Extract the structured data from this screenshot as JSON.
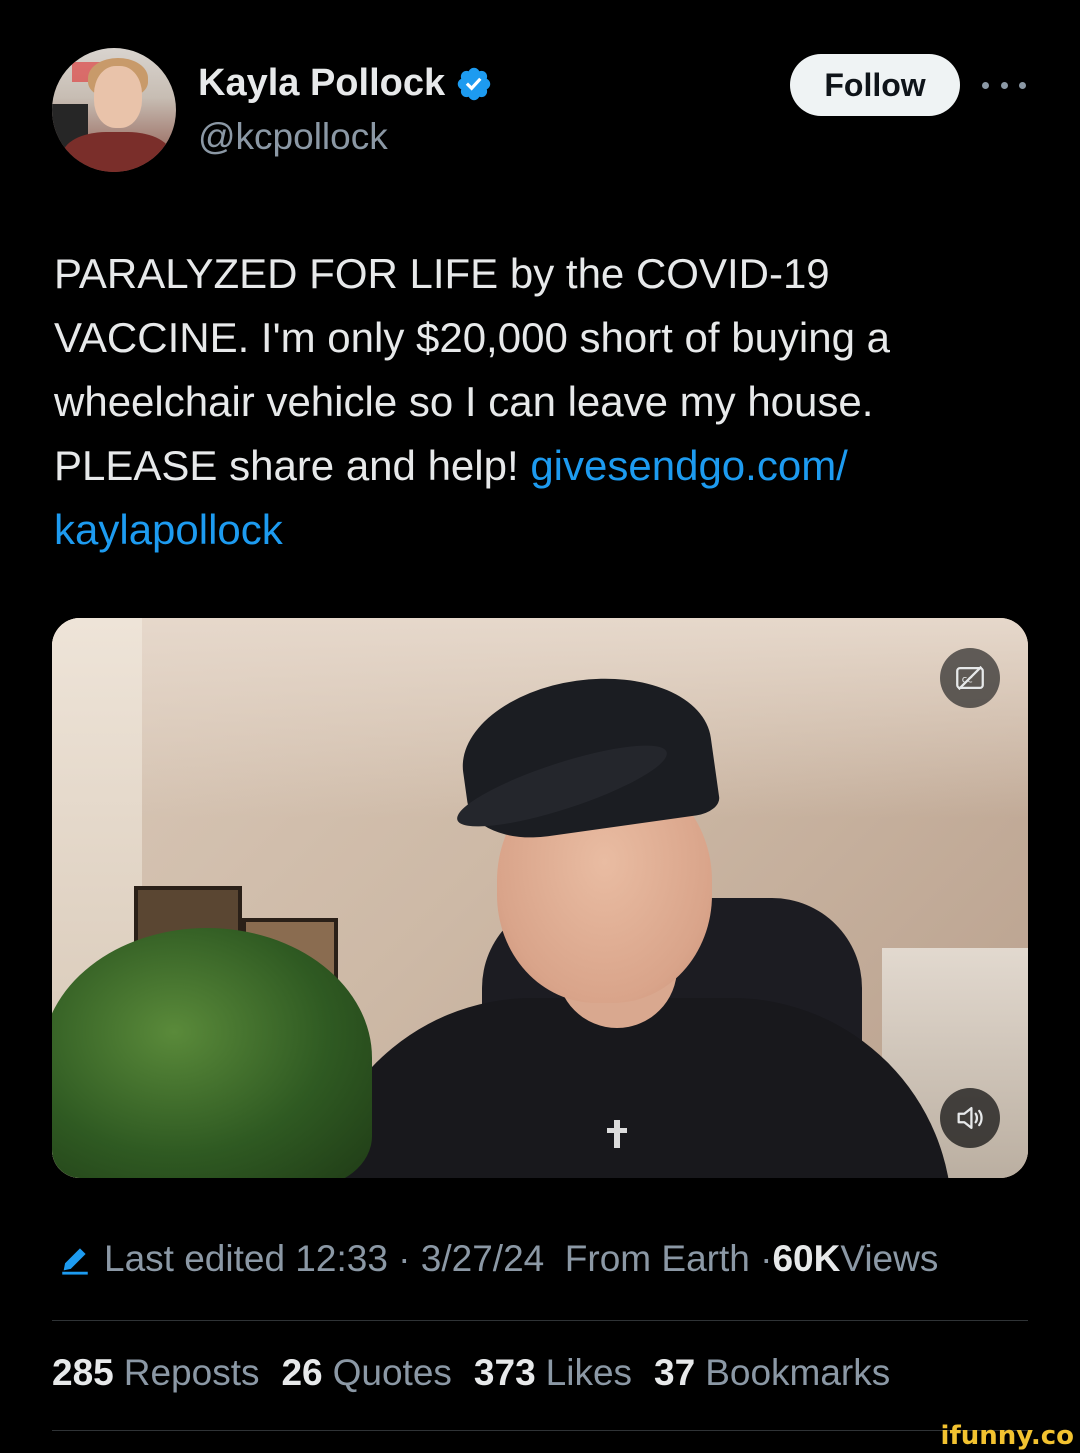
{
  "author": {
    "name": "Kayla Pollock",
    "handle": "@kcpollock",
    "verified": true,
    "verified_color": "#1d9bf0"
  },
  "actions": {
    "follow_label": "Follow",
    "more_icon": "more-horizontal-icon"
  },
  "tweet": {
    "text": "PARALYZED FOR LIFE by the COVID-19 VACCINE. I'm only $20,000 short of buying a wheelchair vehicle so I can leave my house. PLEASE share and help! ",
    "link_text": "givesendgo.com/\nkaylapollock",
    "link_color": "#1d9bf0"
  },
  "media": {
    "type": "video",
    "captions_icon": "captions-off-icon",
    "volume_icon": "volume-icon"
  },
  "meta": {
    "edit_icon": "pencil-icon",
    "last_edited": "Last edited 12:33 · 3/27/24",
    "location": "From Earth · ",
    "views_count": "60K",
    "views_label": " Views"
  },
  "stats": [
    {
      "count": "285",
      "label": "Reposts"
    },
    {
      "count": "26",
      "label": "Quotes"
    },
    {
      "count": "373",
      "label": "Likes"
    },
    {
      "count": "37",
      "label": "Bookmarks"
    }
  ],
  "watermark": "ifunny.co",
  "colors": {
    "background": "#000000",
    "text_primary": "#e7e9ea",
    "text_secondary": "#8b98a5",
    "link": "#1d9bf0"
  }
}
